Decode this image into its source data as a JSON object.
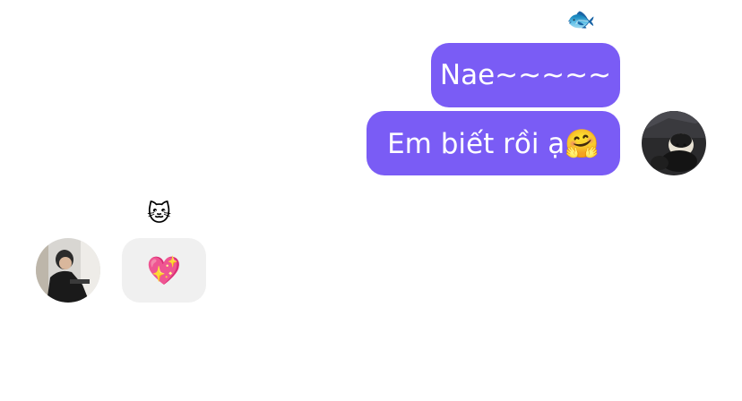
{
  "thread": {
    "outgoing": {
      "reaction_top": "🐟",
      "message_1": "Nae~~~~~",
      "message_2": "Em biết rồi ạ🤗"
    },
    "incoming": {
      "reaction_top": "🐱",
      "message_1": "💖"
    }
  },
  "colors": {
    "outgoing_bubble": "#7a5cf5",
    "incoming_bubble": "#f0f0f0",
    "background": "#ffffff"
  }
}
